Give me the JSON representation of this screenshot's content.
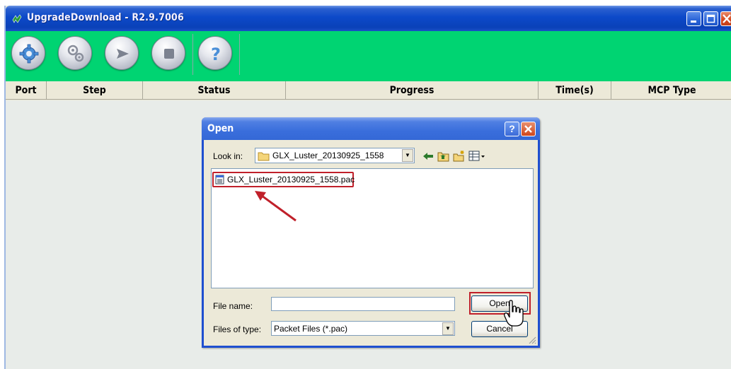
{
  "window": {
    "title": "UpgradeDownload - R2.9.7006",
    "controls": {
      "minimize": "_",
      "maximize": "□",
      "close": "X"
    }
  },
  "toolbar": {
    "buttons": [
      {
        "name": "settings-button",
        "icon": "gear-icon"
      },
      {
        "name": "load-packet-button",
        "icon": "gears-icon"
      },
      {
        "name": "start-button",
        "icon": "play-icon"
      },
      {
        "name": "stop-button",
        "icon": "stop-icon"
      },
      {
        "name": "help-button",
        "icon": "question-icon",
        "label": "?"
      }
    ]
  },
  "columns": [
    "Port",
    "Step",
    "Status",
    "Progress",
    "Time(s)",
    "MCP Type"
  ],
  "dialog": {
    "title": "Open",
    "help": "?",
    "close": "X",
    "look_in_label": "Look in:",
    "look_in_value": "GLX_Luster_20130925_1558",
    "files": [
      "GLX_Luster_20130925_1558.pac"
    ],
    "file_name_label": "File name:",
    "file_name_value": "",
    "files_of_type_label": "Files of type:",
    "files_of_type_value": "Packet Files (*.pac)",
    "open_button": "Open",
    "cancel_button": "Cancel"
  },
  "colors": {
    "titlebar": "#0c49c9",
    "toolbar": "#00d472",
    "highlight": "#c0202a"
  }
}
